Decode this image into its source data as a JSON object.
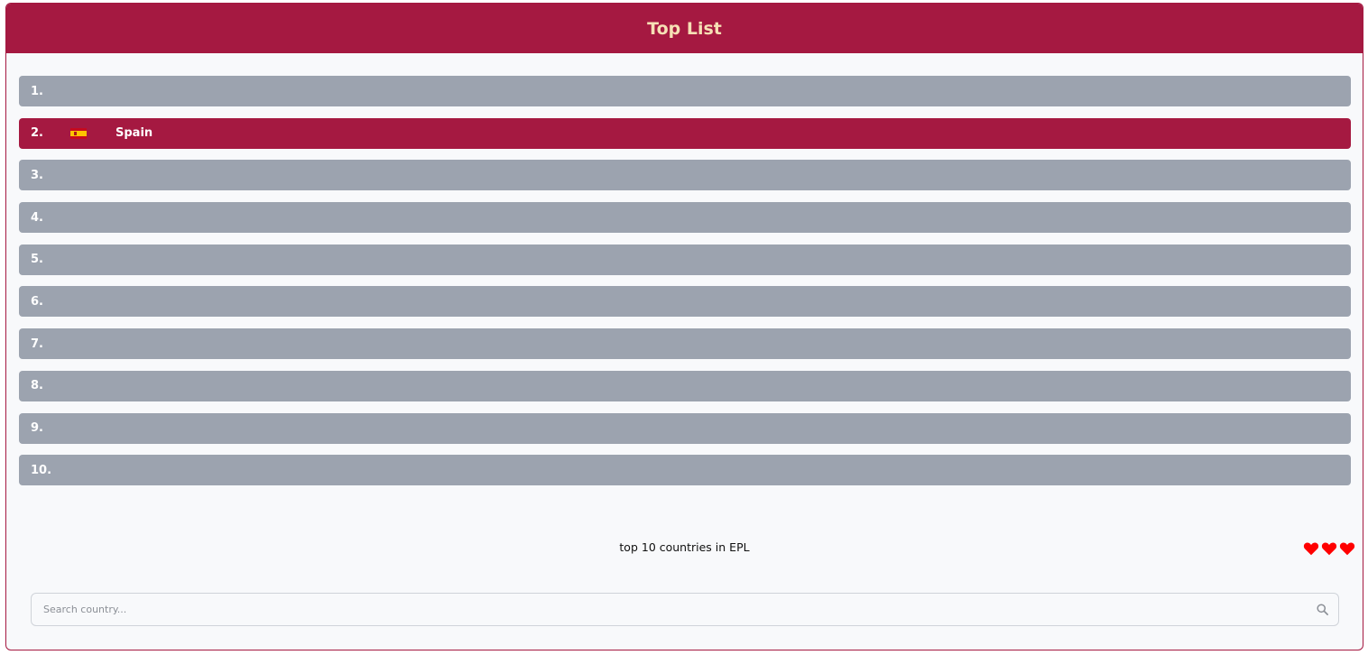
{
  "header": {
    "title": "Top List"
  },
  "list": {
    "items": [
      {
        "rank": "1.",
        "country": "",
        "flag": ""
      },
      {
        "rank": "2.",
        "country": "Spain",
        "flag": "spain-flag-icon"
      },
      {
        "rank": "3.",
        "country": "",
        "flag": ""
      },
      {
        "rank": "4.",
        "country": "",
        "flag": ""
      },
      {
        "rank": "5.",
        "country": "",
        "flag": ""
      },
      {
        "rank": "6.",
        "country": "",
        "flag": ""
      },
      {
        "rank": "7.",
        "country": "",
        "flag": ""
      },
      {
        "rank": "8.",
        "country": "",
        "flag": ""
      },
      {
        "rank": "9.",
        "country": "",
        "flag": ""
      },
      {
        "rank": "10.",
        "country": "",
        "flag": ""
      }
    ]
  },
  "footer": {
    "caption": "top 10 countries in EPL",
    "lives": 3,
    "heart_icon": "heart-icon"
  },
  "search": {
    "placeholder": "Search country...",
    "value": "",
    "icon": "search-icon"
  },
  "colors": {
    "accent": "#a51941",
    "title_text": "#f6e0b5",
    "row_inactive": "#9ca3af",
    "heart": "#ff0000"
  }
}
